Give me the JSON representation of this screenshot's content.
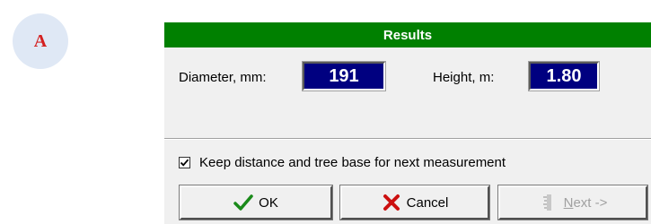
{
  "badge": {
    "letter": "A"
  },
  "dialog": {
    "title": "Results",
    "title_color": "#008000",
    "diameter": {
      "label": "Diameter, mm:",
      "value": "191"
    },
    "height": {
      "label": "Height, m:",
      "value": "1.80"
    },
    "value_box_color": "#000080",
    "keep_checkbox": {
      "label": "Keep distance and tree base for next measurement",
      "checked": true
    },
    "buttons": {
      "ok": {
        "label": "OK",
        "icon": "checkmark-icon"
      },
      "cancel": {
        "label": "Cancel",
        "icon": "x-icon"
      },
      "next": {
        "label": "Next ->",
        "icon": "ruler-icon",
        "enabled": false
      }
    }
  }
}
